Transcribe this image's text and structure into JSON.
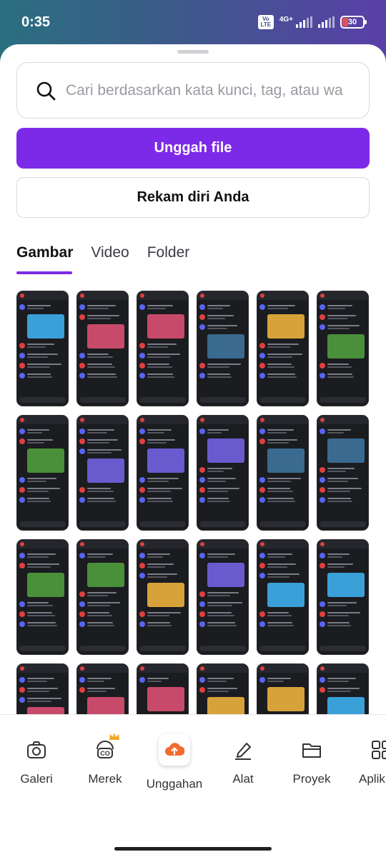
{
  "status": {
    "time": "0:35",
    "volte": "Vo LTE",
    "network": "4G+",
    "battery": "30",
    "battery_level": 0.3,
    "battery_color": "#e05252"
  },
  "search": {
    "placeholder": "Cari berdasarkan kata kunci, tag, atau wa",
    "icon": "search-icon"
  },
  "actions": {
    "upload_label": "Unggah file",
    "record_label": "Rekam diri Anda",
    "accent": "#7d2ae8"
  },
  "tabs": [
    {
      "label": "Gambar",
      "active": true
    },
    {
      "label": "Video",
      "active": false
    },
    {
      "label": "Folder",
      "active": false
    }
  ],
  "gallery": {
    "thumbnail_count": 24,
    "thumbnail_kind": "chat screenshots"
  },
  "bottom_nav": [
    {
      "label": "Galeri",
      "icon": "camera-icon"
    },
    {
      "label": "Merek",
      "icon": "brand-icon",
      "badge": "crown-icon"
    },
    {
      "label": "Unggahan",
      "icon": "cloud-upload-icon",
      "active": true
    },
    {
      "label": "Alat",
      "icon": "pen-tool-icon"
    },
    {
      "label": "Proyek",
      "icon": "folder-icon"
    },
    {
      "label": "Aplik",
      "icon": "apps-icon"
    }
  ]
}
